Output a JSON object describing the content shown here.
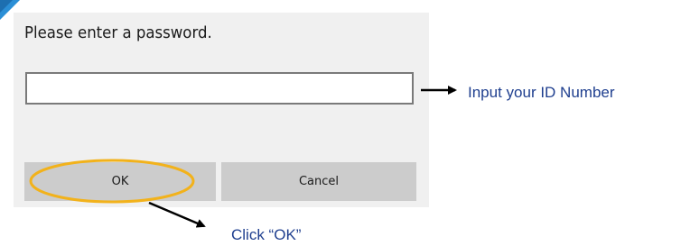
{
  "dialog": {
    "message": "Please enter a password.",
    "password_value": "",
    "ok_label": "OK",
    "cancel_label": "Cancel"
  },
  "annotations": {
    "input_hint": "Input your ID Number",
    "ok_hint": "Click “OK”",
    "hint_color": "#1f3f8f",
    "highlight_color": "#f2b21b",
    "arrow_color": "#000000"
  },
  "colors": {
    "dialog_background": "#f0f0f0",
    "button_background": "#cccccc",
    "input_border": "#7a7a7a",
    "corner_accent": "#2b8fd6"
  }
}
